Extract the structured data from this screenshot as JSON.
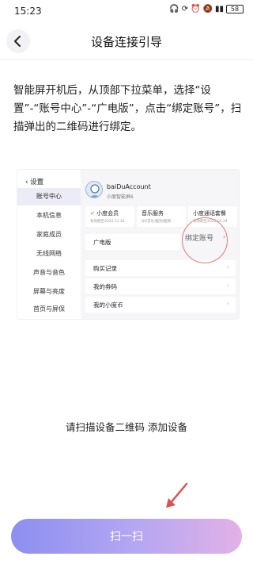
{
  "status_bar": {
    "time": "15:23",
    "battery": "58"
  },
  "nav": {
    "title": "设备连接引导"
  },
  "instructions": "智能屏开机后，从顶部下拉菜单，选择“设置”-“账号中心”-“广电版”，点击“绑定账号”，扫描弹出的二维码进行绑定。",
  "figure": {
    "back_label": "设置",
    "sidebar_items": [
      "账号中心",
      "本机信息",
      "家庭成员",
      "无线网络",
      "声音与音色",
      "屏幕与亮度",
      "首页与屏保"
    ],
    "account_name": "baiDuAccount",
    "device_name": "小度智能屏6",
    "cards": [
      {
        "title": "小度会员",
        "sub": "有效期至2022.11.24"
      },
      {
        "title": "音乐服务",
        "sub": "QQ音乐/酷狗/酷我"
      },
      {
        "title": "小度通话套餐",
        "sub": "有效期至2022.05.24"
      }
    ],
    "rows": [
      "广电版",
      "购买记录",
      "我的券码",
      "我的小度币"
    ],
    "bind_label": "绑定账号"
  },
  "scan_hint": "请扫描设备二维码 添加设备",
  "scan_button": "扫一扫",
  "colors": {
    "button_gradient_start": "#8c8ff0",
    "button_gradient_end": "#e2b1e6",
    "highlight_circle": "#e27a73",
    "arrow": "#d9534f"
  }
}
